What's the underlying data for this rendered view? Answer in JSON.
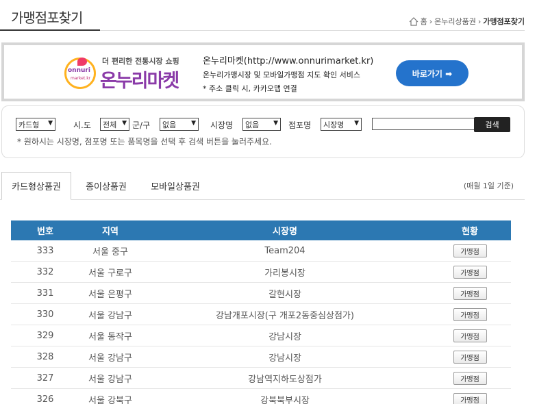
{
  "header": {
    "title": "가맹점포찾기",
    "breadcrumb": {
      "home": "홈",
      "section": "온누리상품권",
      "current": "가맹점포찾기"
    }
  },
  "banner": {
    "logo_sub": "더 편리한 전통시장 쇼핑",
    "logo_main": "온누리마켓",
    "logo_badge": "onnuri",
    "logo_badge_small": "market.kr",
    "url_line": "온누리마켓(http://www.onnurimarket.kr)",
    "desc_line": "온누리가맹시장 및 모바일가맹점 지도 확인 서비스",
    "note_line": "* 주소 클릭 시, 카카오맵 연결",
    "go_button": "바로가기 ➡"
  },
  "search": {
    "type_select": "카드형",
    "sido_label": "시.도",
    "sido_select": "전체",
    "gugun_label": "군/구",
    "gugun_select": "없음",
    "market_label": "시장명",
    "market_select": "없음",
    "store_label": "점포명",
    "store_select": "시장명",
    "input_value": "",
    "search_button": "검색",
    "note": "* 원하시는 시장명, 점포명 또는 품목명을 선택 후 검색 버튼을 눌러주세요."
  },
  "tabs": {
    "items": [
      {
        "label": "카드형상품권",
        "active": true
      },
      {
        "label": "종이상품권",
        "active": false
      },
      {
        "label": "모바일상품권",
        "active": false
      }
    ],
    "note": "(매월 1일 기준)"
  },
  "table": {
    "headers": [
      "번호",
      "지역",
      "시장명",
      "현황"
    ],
    "rows": [
      {
        "no": "333",
        "region": "서울 중구",
        "market": "Team204",
        "status": "가맹점"
      },
      {
        "no": "332",
        "region": "서울 구로구",
        "market": "가리봉시장",
        "status": "가맹점"
      },
      {
        "no": "331",
        "region": "서울 은평구",
        "market": "갈현시장",
        "status": "가맹점"
      },
      {
        "no": "330",
        "region": "서울 강남구",
        "market": "강남개포시장(구 개포2동중심상점가)",
        "status": "가맹점"
      },
      {
        "no": "329",
        "region": "서울 동작구",
        "market": "강남시장",
        "status": "가맹점"
      },
      {
        "no": "328",
        "region": "서울 강남구",
        "market": "강남시장",
        "status": "가맹점"
      },
      {
        "no": "327",
        "region": "서울 강남구",
        "market": "강남역지하도상점가",
        "status": "가맹점"
      },
      {
        "no": "326",
        "region": "서울 강북구",
        "market": "강북북부시장",
        "status": "가맹점"
      }
    ]
  },
  "colors": {
    "accent": "#2473cc",
    "table_header": "#2c78b2"
  }
}
